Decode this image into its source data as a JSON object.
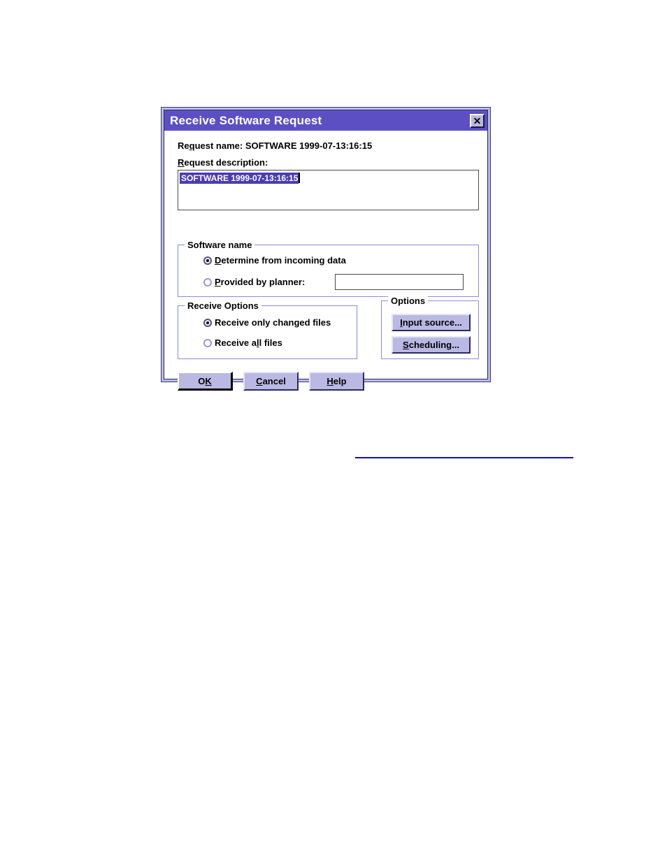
{
  "dialog": {
    "title": "Receive Software Request",
    "close_label": "✕",
    "request_name_label": "Re",
    "request_name_mnemonic": "q",
    "request_name_rest": "uest name:  SOFTWARE 1999-07-13:16:15",
    "request_description_mnemonic": "R",
    "request_description_rest": "equest description:",
    "description_value": "SOFTWARE 1999-07-13:16:15"
  },
  "software_name_group": {
    "label": "Software name",
    "options": [
      {
        "pre": "",
        "mnemonic": "D",
        "post": "etermine from incoming data",
        "checked": true
      },
      {
        "pre": "",
        "mnemonic": "P",
        "post": "rovided by planner:",
        "checked": false
      }
    ],
    "planner_input_value": "",
    "planner_input_placeholder": ""
  },
  "receive_options_group": {
    "label": "Receive Options",
    "options": [
      {
        "pre": "Receive only chan",
        "mnemonic": "g",
        "post": "ed files",
        "checked": true
      },
      {
        "pre": "Receive a",
        "mnemonic": "l",
        "post": "l files",
        "checked": false
      }
    ]
  },
  "options_group": {
    "label": "Options",
    "buttons": [
      {
        "pre": "",
        "mnemonic": "I",
        "post": "nput source..."
      },
      {
        "pre": "",
        "mnemonic": "S",
        "post": "cheduling..."
      }
    ]
  },
  "action_buttons": [
    {
      "pre": "O",
      "mnemonic": "K",
      "post": "",
      "default": true
    },
    {
      "pre": "",
      "mnemonic": "C",
      "post": "ancel",
      "default": false
    },
    {
      "pre": "",
      "mnemonic": "H",
      "post": "elp",
      "default": false
    }
  ],
  "colors": {
    "titlebar": "#5c4fc4",
    "button_face": "#b9b9e4",
    "selection": "#4a3cb4",
    "group_border": "#8a8ad8",
    "link_rule": "#1010c0"
  }
}
